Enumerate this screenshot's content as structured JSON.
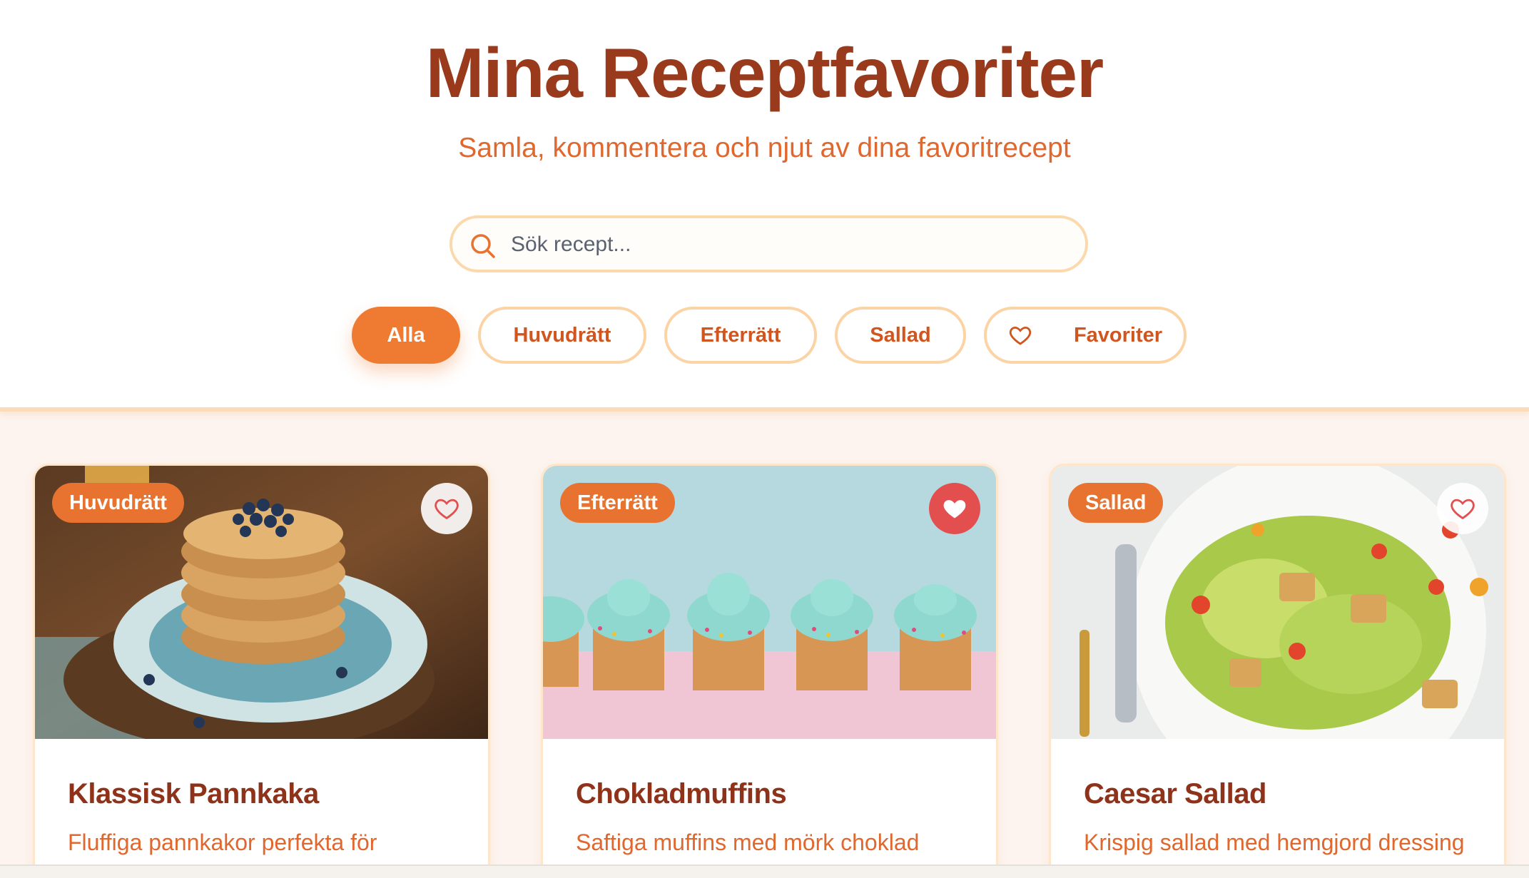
{
  "header": {
    "title": "Mina Receptfavoriter",
    "subtitle": "Samla, kommentera och njut av dina favoritrecept"
  },
  "search": {
    "placeholder": "Sök recept...",
    "icon": "search-icon"
  },
  "filters": [
    {
      "label": "Alla",
      "active": true
    },
    {
      "label": "Huvudrätt",
      "active": false
    },
    {
      "label": "Efterrätt",
      "active": false
    },
    {
      "label": "Sallad",
      "active": false
    },
    {
      "label": "Favoriter",
      "active": false,
      "icon": "heart-outline-icon"
    }
  ],
  "recipes": [
    {
      "category": "Huvudrätt",
      "title": "Klassisk Pannkaka",
      "description": "Fluffiga pannkakor perfekta för",
      "favorite": false,
      "image": "pancake-stack-photo"
    },
    {
      "category": "Efterrätt",
      "title": "Chokladmuffins",
      "description": "Saftiga muffins med mörk choklad",
      "favorite": true,
      "image": "cupcakes-photo"
    },
    {
      "category": "Sallad",
      "title": "Caesar Sallad",
      "description": "Krispig sallad med hemgjord dressing",
      "favorite": false,
      "image": "caesar-salad-photo"
    }
  ],
  "colors": {
    "accent": "#ef7a32",
    "title": "#9a3a1c",
    "subtitle": "#e0672d",
    "favorite_on": "#e34f4f"
  }
}
